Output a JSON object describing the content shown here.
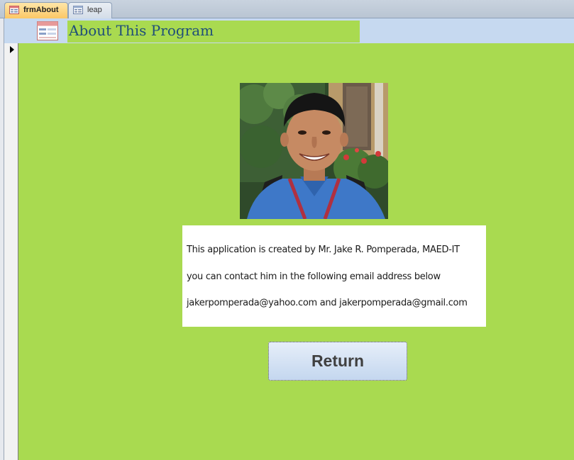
{
  "tabs": [
    {
      "label": "frmAbout",
      "active": true,
      "icon": "form-icon"
    },
    {
      "label": "leap",
      "active": false,
      "icon": "form-icon"
    }
  ],
  "header": {
    "title": "About This Program",
    "icon": "form-icon"
  },
  "info": {
    "lines": [
      "This application is created by Mr. Jake R. Pomperada, MAED-IT",
      "you can contact him in the following email address below",
      "jakerpomperada@yahoo.com and jakerpomperada@gmail.com"
    ]
  },
  "buttons": {
    "return_label": "Return"
  },
  "colors": {
    "form_background": "#a9da50",
    "header_background": "#c6d9f0",
    "title_text": "#1f4e79",
    "active_tab": "#fbc765"
  }
}
